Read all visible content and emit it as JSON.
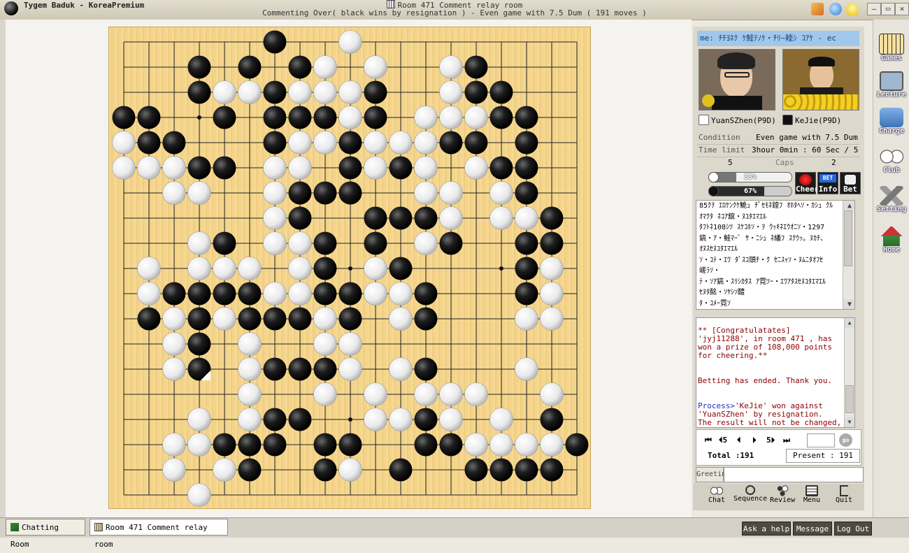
{
  "app": {
    "title": "Tygem Baduk - KoreaPremium",
    "room_title": "Room 471 Comment relay room",
    "subtitle": "Commenting Over( black wins by resignation ) - Even game with 7.5 Dum  ( 191 moves )"
  },
  "board": {
    "size": 19,
    "star_points": [
      [
        3,
        3
      ],
      [
        3,
        9
      ],
      [
        3,
        15
      ],
      [
        9,
        3
      ],
      [
        9,
        9
      ],
      [
        9,
        15
      ],
      [
        15,
        3
      ],
      [
        15,
        9
      ],
      [
        15,
        15
      ]
    ],
    "last_move": [
      13,
      3
    ],
    "black": [
      [
        0,
        6
      ],
      [
        1,
        3
      ],
      [
        1,
        5
      ],
      [
        1,
        7
      ],
      [
        1,
        14
      ],
      [
        2,
        3
      ],
      [
        2,
        6
      ],
      [
        2,
        10
      ],
      [
        2,
        14
      ],
      [
        2,
        15
      ],
      [
        3,
        0
      ],
      [
        3,
        1
      ],
      [
        3,
        4
      ],
      [
        3,
        6
      ],
      [
        3,
        7
      ],
      [
        3,
        8
      ],
      [
        3,
        10
      ],
      [
        3,
        15
      ],
      [
        3,
        16
      ],
      [
        4,
        1
      ],
      [
        4,
        2
      ],
      [
        4,
        6
      ],
      [
        4,
        9
      ],
      [
        4,
        13
      ],
      [
        4,
        14
      ],
      [
        4,
        16
      ],
      [
        5,
        3
      ],
      [
        5,
        4
      ],
      [
        5,
        9
      ],
      [
        5,
        11
      ],
      [
        5,
        15
      ],
      [
        5,
        16
      ],
      [
        6,
        7
      ],
      [
        6,
        8
      ],
      [
        6,
        9
      ],
      [
        6,
        16
      ],
      [
        7,
        7
      ],
      [
        7,
        10
      ],
      [
        7,
        11
      ],
      [
        7,
        12
      ],
      [
        7,
        17
      ],
      [
        8,
        4
      ],
      [
        8,
        8
      ],
      [
        8,
        10
      ],
      [
        8,
        13
      ],
      [
        8,
        16
      ],
      [
        8,
        17
      ],
      [
        9,
        8
      ],
      [
        9,
        11
      ],
      [
        9,
        16
      ],
      [
        10,
        2
      ],
      [
        10,
        3
      ],
      [
        10,
        4
      ],
      [
        10,
        5
      ],
      [
        10,
        8
      ],
      [
        10,
        9
      ],
      [
        10,
        12
      ],
      [
        10,
        16
      ],
      [
        11,
        1
      ],
      [
        11,
        3
      ],
      [
        11,
        5
      ],
      [
        11,
        6
      ],
      [
        11,
        7
      ],
      [
        11,
        9
      ],
      [
        11,
        12
      ],
      [
        12,
        3
      ],
      [
        13,
        3
      ],
      [
        13,
        6
      ],
      [
        13,
        7
      ],
      [
        13,
        8
      ],
      [
        13,
        12
      ],
      [
        15,
        6
      ],
      [
        15,
        7
      ],
      [
        15,
        12
      ],
      [
        15,
        17
      ],
      [
        16,
        4
      ],
      [
        16,
        5
      ],
      [
        16,
        6
      ],
      [
        16,
        8
      ],
      [
        16,
        9
      ],
      [
        16,
        12
      ],
      [
        16,
        13
      ],
      [
        16,
        18
      ],
      [
        17,
        5
      ],
      [
        17,
        8
      ],
      [
        17,
        11
      ],
      [
        17,
        14
      ],
      [
        17,
        15
      ],
      [
        17,
        16
      ],
      [
        17,
        17
      ]
    ],
    "white": [
      [
        0,
        9
      ],
      [
        1,
        8
      ],
      [
        1,
        10
      ],
      [
        1,
        13
      ],
      [
        2,
        4
      ],
      [
        2,
        5
      ],
      [
        2,
        7
      ],
      [
        2,
        8
      ],
      [
        2,
        9
      ],
      [
        2,
        13
      ],
      [
        3,
        9
      ],
      [
        3,
        12
      ],
      [
        3,
        13
      ],
      [
        3,
        14
      ],
      [
        4,
        0
      ],
      [
        4,
        7
      ],
      [
        4,
        8
      ],
      [
        4,
        10
      ],
      [
        4,
        11
      ],
      [
        4,
        12
      ],
      [
        5,
        0
      ],
      [
        5,
        1
      ],
      [
        5,
        2
      ],
      [
        5,
        6
      ],
      [
        5,
        7
      ],
      [
        5,
        10
      ],
      [
        5,
        12
      ],
      [
        5,
        14
      ],
      [
        6,
        2
      ],
      [
        6,
        3
      ],
      [
        6,
        6
      ],
      [
        6,
        12
      ],
      [
        6,
        13
      ],
      [
        6,
        15
      ],
      [
        7,
        6
      ],
      [
        7,
        13
      ],
      [
        7,
        15
      ],
      [
        7,
        16
      ],
      [
        8,
        3
      ],
      [
        8,
        6
      ],
      [
        8,
        7
      ],
      [
        8,
        12
      ],
      [
        9,
        1
      ],
      [
        9,
        3
      ],
      [
        9,
        4
      ],
      [
        9,
        5
      ],
      [
        9,
        7
      ],
      [
        9,
        10
      ],
      [
        9,
        17
      ],
      [
        10,
        1
      ],
      [
        10,
        6
      ],
      [
        10,
        7
      ],
      [
        10,
        10
      ],
      [
        10,
        11
      ],
      [
        10,
        17
      ],
      [
        11,
        2
      ],
      [
        11,
        4
      ],
      [
        11,
        8
      ],
      [
        11,
        11
      ],
      [
        11,
        16
      ],
      [
        11,
        17
      ],
      [
        12,
        2
      ],
      [
        12,
        5
      ],
      [
        12,
        8
      ],
      [
        12,
        9
      ],
      [
        13,
        2
      ],
      [
        13,
        5
      ],
      [
        13,
        9
      ],
      [
        13,
        11
      ],
      [
        13,
        16
      ],
      [
        14,
        5
      ],
      [
        14,
        8
      ],
      [
        14,
        10
      ],
      [
        14,
        12
      ],
      [
        14,
        13
      ],
      [
        14,
        14
      ],
      [
        14,
        17
      ],
      [
        15,
        3
      ],
      [
        15,
        5
      ],
      [
        15,
        10
      ],
      [
        15,
        11
      ],
      [
        15,
        13
      ],
      [
        15,
        15
      ],
      [
        16,
        2
      ],
      [
        16,
        3
      ],
      [
        16,
        14
      ],
      [
        16,
        15
      ],
      [
        16,
        16
      ],
      [
        16,
        17
      ],
      [
        17,
        2
      ],
      [
        17,
        4
      ],
      [
        17,
        9
      ],
      [
        18,
        3
      ]
    ]
  },
  "panel": {
    "title_strip": "me: ﾁﾁﾖﾈｸ ｹ鮭ﾃﾉｹ・ﾁﾘ~睦ｼ ｺｱｹ  - ec",
    "white_player": "YuanSZhen(P9D)",
    "black_player": "KeJie(P9D)",
    "condition_label": "Condition",
    "condition_value": "Even game with 7.5 Dum",
    "time_label": "Time limit",
    "time_value": "3hour 0min : 60 Sec / 5",
    "caps_label": "Caps",
    "caps_white": "5",
    "caps_black": "2",
    "white_pct": "33%",
    "white_ratio": 0.33,
    "black_pct": "67%",
    "black_ratio": 0.67,
    "cheer_label": "Cheer",
    "info_label": "Info",
    "bet_label": "Bet",
    "bet_badge": "BET"
  },
  "comments": [
    "85ｸｦ ｴﾛｹﾝｸｹ鮠ｭ ﾁﾟｾﾓﾈ鍠ﾌ ｵﾎﾀﾍｿ・ｶｼｭ ｸﾙ",
    "ｵﾏｸﾀ ﾈｺｱ舘・ﾇﾕﾀｴﾏｴﾙ",
    "ﾀﾌﾄﾈ108ｼﾂ ｽｹｺﾎｿ・ｦ ｳｯｷﾈｴｳｵﾆｿ・1297",
    "鎬・ｱ・鮭ﾏｰﾞ ｻ・ﾆｼｭ ﾈ繙ﾌ ｽｸｳｯ。ﾇｶﾁ、",
    "ｵﾇｽｾﾇﾕﾀｴﾏｴﾙ",
    "ｿ・ｺﾃ・ｴﾜ ﾀﾟｽｺ頭ﾁ・ｸ ｾﾆｽｬｿ・ﾇﾑﾆﾀｵﾌｾ",
    "嵯ﾗｿ・",
    "ﾃ・ｿｱ鎬・ｽﾘｼｶﾀｽ ｱ霓ﾂｰ・ｴﾜｱﾀｽｾﾇﾕﾀｴﾏｴﾙ",
    "ｾﾇﾀ酩・ｿﾔｼｿ醴",
    "ﾀ・ｺﾒｰ霓ｿ"
  ],
  "chat": {
    "congrats": "** [Congratulatates] 'jyj11288', in room 471 , has won a prize of 108,000 points for cheering.**",
    "betting": "Betting has ended. Thank you.",
    "process_tag": "Process>",
    "process_msg": "'KeJie' won against 'YuanSZhen' by resignation.",
    "result_msg": "The result will not be changed, in accordance with Tygem rules."
  },
  "nav": {
    "first": "⏮",
    "back5": "⏴5",
    "back1": "⏴",
    "fwd1": "⏵",
    "fwd5": "5⏵",
    "last": "⏭",
    "go": "go",
    "total": "Total :191",
    "present": "Present : 191"
  },
  "greeting": "Greeting",
  "tools": {
    "chat": "Chat",
    "sequence": "Sequence",
    "review": "Review",
    "menu": "Menu",
    "quit": "Quit"
  },
  "side": {
    "games": "Games",
    "lecture": "Lecture",
    "charge": "Charge",
    "club": "Club",
    "setting": "Setting",
    "home": "Home"
  },
  "taskbar": {
    "chat_room": "Chatting Room",
    "room_tab": "Room 471 Comment relay room",
    "ask_help": "Ask a help",
    "message": "Message",
    "logout": "Log Out"
  },
  "colors": {
    "board_wood": "#f4d48c",
    "title_strip": "#9fc8ea",
    "chat_red": "#8b0000",
    "process_blue": "#1b2fb4"
  }
}
